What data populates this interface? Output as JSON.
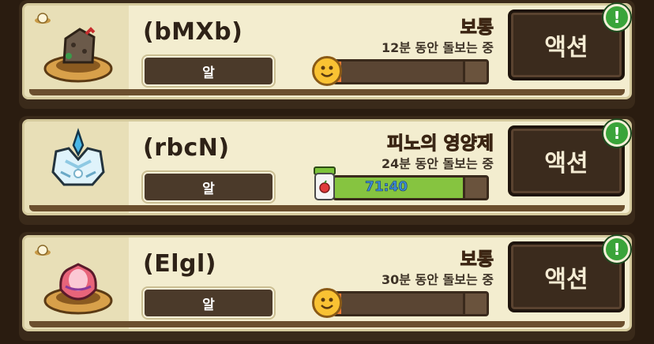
{
  "pets": [
    {
      "name": "(bMXb)",
      "type": "알",
      "status": "보통",
      "status_kind": "normal",
      "care_text": "12분 동안 돌보는 중",
      "bar_fill_fraction": 0.04,
      "bar_text": "",
      "bar_icon": "smiley-icon",
      "egg_corner": true,
      "action_label": "액션",
      "alert": "!"
    },
    {
      "name": "(rbcN)",
      "type": "알",
      "status": "피노의 영양제",
      "status_kind": "boost",
      "care_text": "24분 동안 돌보는 중",
      "bar_fill_fraction": 0.85,
      "bar_text": "71:40",
      "bar_icon": "nutrient-jar-icon",
      "egg_corner": false,
      "action_label": "액션",
      "alert": "!"
    },
    {
      "name": "(Elgl)",
      "type": "알",
      "status": "보통",
      "status_kind": "normal",
      "care_text": "30분 동안 돌보는 중",
      "bar_fill_fraction": 0.04,
      "bar_text": "",
      "bar_icon": "smiley-icon",
      "egg_corner": true,
      "action_label": "액션",
      "alert": "!"
    }
  ],
  "colors": {
    "card_bg": "#f3edcf",
    "status_normal": "#f26b2a",
    "status_boost": "#4ab7e6",
    "bar_fill_normal": "#f07a34",
    "bar_fill_boost": "#86c440",
    "alert_badge": "#3aa43a"
  }
}
